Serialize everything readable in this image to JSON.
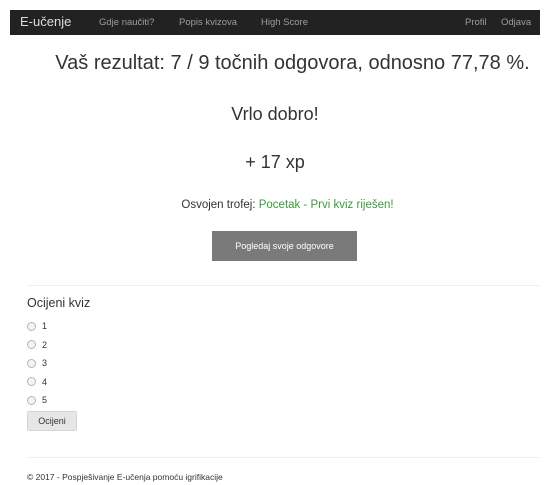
{
  "nav": {
    "brand": "E-učenje",
    "links": [
      "Gdje naučiti?",
      "Popis kvizova",
      "High Score"
    ],
    "right_links": [
      "Profil",
      "Odjava"
    ]
  },
  "result": {
    "title": "Vaš rezultat: 7 / 9 točnih odgovora, odnosno 77,78 %.",
    "grade": "Vrlo dobro!",
    "xp": "+ 17 xp",
    "trophy_label": "Osvojen trofej: ",
    "trophy_name": "Pocetak - Prvi kviz riješen!",
    "review_button": "Pogledaj svoje odgovore"
  },
  "rating": {
    "heading": "Ocijeni kviz",
    "options": [
      "1",
      "2",
      "3",
      "4",
      "5"
    ],
    "submit": "Ocijeni"
  },
  "footer": "© 2017 - Pospješivanje E-učenja pomoću igrifikacije",
  "colors": {
    "navbar": "#222222",
    "trophy_green": "#3c9a3c",
    "review_button": "#7a7a7a"
  }
}
